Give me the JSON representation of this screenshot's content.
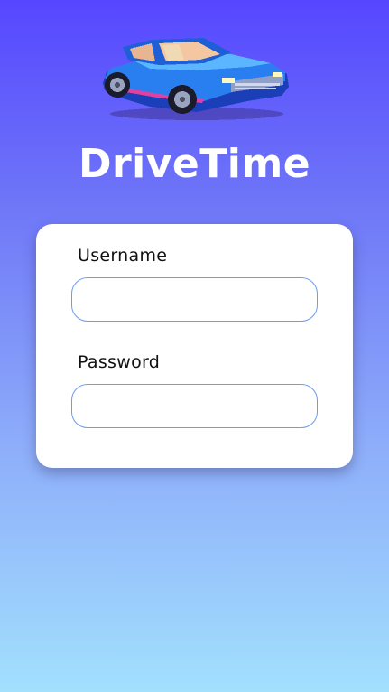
{
  "app": {
    "title": "DriveTime",
    "logo_icon": "car-icon"
  },
  "login_form": {
    "username_label": "Username",
    "username_value": "",
    "username_placeholder": "",
    "password_label": "Password",
    "password_value": "",
    "password_placeholder": ""
  },
  "colors": {
    "gradient_top": "#5647ff",
    "gradient_bottom": "#a2e0fd",
    "card_background": "#ffffff",
    "input_border": "#6a9cf0",
    "title_text": "#ffffff"
  }
}
